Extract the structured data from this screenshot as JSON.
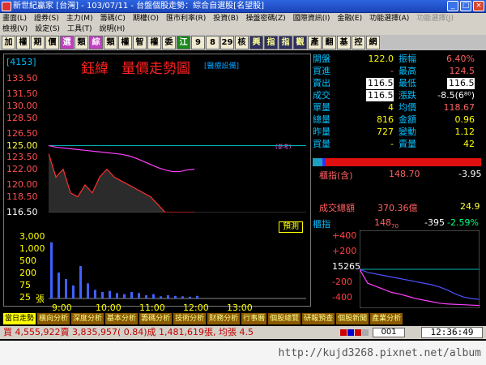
{
  "window": {
    "title": "新世紀贏家 [台灣] - 103/07/11 - 台盤個股走勢：綜合自選股[名望股]"
  },
  "menu_primary": [
    "畫面(L)",
    "證券(S)",
    "主力(M)",
    "籌碼(C)",
    "期權(O)",
    "匯市利率(R)",
    "投資(B)",
    "操盤密碼(Z)",
    "國際資訊(I)",
    "金融(E)",
    "功能選擇(A)"
  ],
  "menu_primary_disabled": [
    "功能選擇(J)"
  ],
  "menu_secondary": [
    "檢視(V)",
    "設定(S)",
    "工具(T)",
    "說明(H)"
  ],
  "toolbar": [
    "加",
    "權",
    "期",
    "價",
    "選",
    "類",
    "綜",
    "類",
    "權",
    "智",
    "權",
    "委",
    "江",
    "9",
    "8",
    "29",
    "核",
    "興",
    "指",
    "指",
    "觀",
    "產",
    "翻",
    "基",
    "控",
    "網"
  ],
  "chart": {
    "code": "[4153]",
    "name": "鈺緯",
    "title": "量價走勢圖",
    "category": "[醫療設備]",
    "reference_note": "(參考)",
    "tag": "預測",
    "x_ticks": [
      "9:00",
      "10:00",
      "11:00",
      "12:00",
      "13:00"
    ],
    "volume_side_label": "張"
  },
  "chart_data": {
    "type": "line",
    "price_axis": {
      "ticks": [
        "133.50",
        "131.50",
        "130.00",
        "128.50",
        "126.50",
        "125.00",
        "123.50",
        "122.00",
        "120.00",
        "118.50",
        "116.50"
      ],
      "ylim": [
        116.5,
        133.5
      ],
      "reference": 125.0,
      "last": 116.5
    },
    "volume_axis": {
      "ticks": [
        "3,000",
        "1,000",
        "500",
        "200",
        "75",
        "25"
      ]
    },
    "x_time": [
      "9:00",
      "9:10",
      "9:20",
      "9:30",
      "9:40",
      "9:50",
      "10:00",
      "10:10",
      "10:20",
      "10:30",
      "10:40",
      "10:50",
      "11:00",
      "11:10",
      "11:20",
      "11:30",
      "11:40",
      "11:50",
      "12:00",
      "12:10",
      "12:20"
    ],
    "series": [
      {
        "name": "price",
        "values": [
          124,
          121,
          122,
          119,
          118.5,
          120,
          119,
          121,
          122,
          121,
          120.5,
          120,
          119.5,
          119,
          118.5,
          117.5,
          116.5,
          116.5,
          116.5,
          116.5,
          116.5
        ]
      },
      {
        "name": "average",
        "values": [
          125,
          124.8,
          124.7,
          124.6,
          124.5,
          124.4,
          124.3,
          124.2,
          124.1,
          124.0,
          123.9,
          123.7,
          123.4,
          123.0,
          122.6,
          122.2,
          121.9,
          121.7,
          121.7,
          121.9,
          122.0
        ]
      }
    ],
    "volume": [
      260,
      120,
      90,
      60,
      150,
      70,
      40,
      30,
      35,
      25,
      20,
      30,
      25,
      15,
      20,
      10,
      15,
      12,
      10,
      8,
      12
    ]
  },
  "quote": {
    "open_label": "開盤",
    "open": "122.0",
    "amp_label": "振幅",
    "amp": "6.40%",
    "buy_label": "買進",
    "buy": "-",
    "high_label": "最高",
    "high": "124.5",
    "sell_label": "賣出",
    "sell": "116.5",
    "low_label": "最低",
    "low": "116.5",
    "deal_label": "成交",
    "deal": "116.5",
    "chg_label": "漲跌",
    "chg": "-8.5(6⁸⁰)",
    "single_label": "單量",
    "single": "4",
    "avg_label": "均價",
    "avg": "118.67",
    "total_label": "總量",
    "total": "816",
    "amount_label": "金額",
    "amount": "0.96",
    "yday_label": "昨量",
    "yday": "727",
    "vchg_label": "變動",
    "vchg": "1.12",
    "bvol_label": "買量",
    "bvol": "-",
    "svol_label": "賣量",
    "svol": "42"
  },
  "otc_index": {
    "label": "櫃指(含)",
    "value": "148.70",
    "change": "-3.95",
    "amount_label": "成交總額",
    "amount": "370.36億",
    "amount_pct": "24.9"
  },
  "index_chart": {
    "label": "櫃指",
    "value": "148",
    "value_sub": "70",
    "change": "-395",
    "change_pct": "-2.59%",
    "ticks": [
      "+400",
      "+200",
      "15265",
      "-200",
      "-400"
    ],
    "line_a": [
      0.0,
      -40,
      -60,
      -80,
      -100,
      -120,
      -140,
      -160,
      -180,
      -200,
      -230,
      -270,
      -320,
      -360,
      -380,
      -390
    ],
    "line_b": [
      0.0,
      -180,
      -220,
      -260,
      -300,
      -320,
      -350,
      -380,
      -400,
      -420,
      -440,
      -450,
      -455,
      -460,
      -465,
      -470
    ]
  },
  "tabs": [
    "當日走勢",
    "橫向分析",
    "深度分析",
    "基本分析",
    "籌碼分析",
    "技術分析",
    "財務分析",
    "行事曆",
    "個股總覽",
    "研報預查",
    "個股新聞",
    "產業分析"
  ],
  "status": {
    "ticker": "買 4,555,922賣 3,835,957( 0.84)成 1,481,619張, 均張 4.5",
    "page": "001",
    "clock": "12:36:49"
  },
  "watermark": "http://kujd3268.pixnet.net/album",
  "colors": {
    "price": "#ff3030",
    "average": "#ff40ff",
    "reference": "#00b0b0",
    "volume": "#4060ff",
    "index_a": "#5050ff",
    "index_b": "#ff40ff"
  }
}
